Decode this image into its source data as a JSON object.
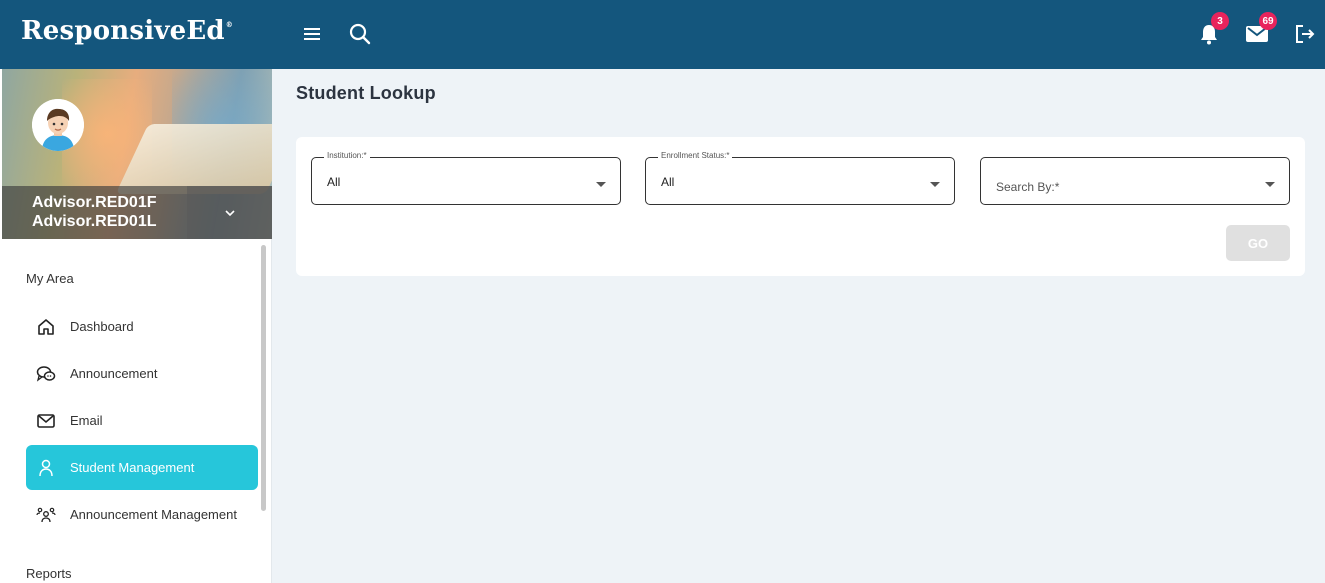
{
  "header": {
    "logo": "ResponsiveEd",
    "logo_mark": "®",
    "notifications_count": "3",
    "messages_count": "69",
    "icons": [
      "menu-icon",
      "search-icon",
      "bell-icon",
      "mail-icon",
      "logout-icon"
    ]
  },
  "profile": {
    "first_line": "Advisor.RED01F",
    "second_line": "Advisor.RED01L"
  },
  "sidebar": {
    "my_area_label": "My Area",
    "items": [
      {
        "label": "Dashboard",
        "icon": "home-icon"
      },
      {
        "label": "Announcement",
        "icon": "chat-bubbles-icon"
      },
      {
        "label": "Email",
        "icon": "envelope-icon"
      },
      {
        "label": "Student Management",
        "icon": "user-icon",
        "active": true
      },
      {
        "label": "Announcement Management",
        "icon": "group-icon"
      }
    ],
    "reports_label": "Reports"
  },
  "main": {
    "title": "Student Lookup",
    "filters": {
      "institution": {
        "label": "Institution:*",
        "value": "All"
      },
      "enrollment_status": {
        "label": "Enrollment Status:*",
        "value": "All"
      },
      "search_by": {
        "placeholder": "Search By:*"
      }
    },
    "go_label": "GO"
  },
  "colors": {
    "header_bg": "#14567d",
    "active_item": "#26c6da",
    "badge": "#e8245c",
    "page_bg": "#eef3f7"
  }
}
